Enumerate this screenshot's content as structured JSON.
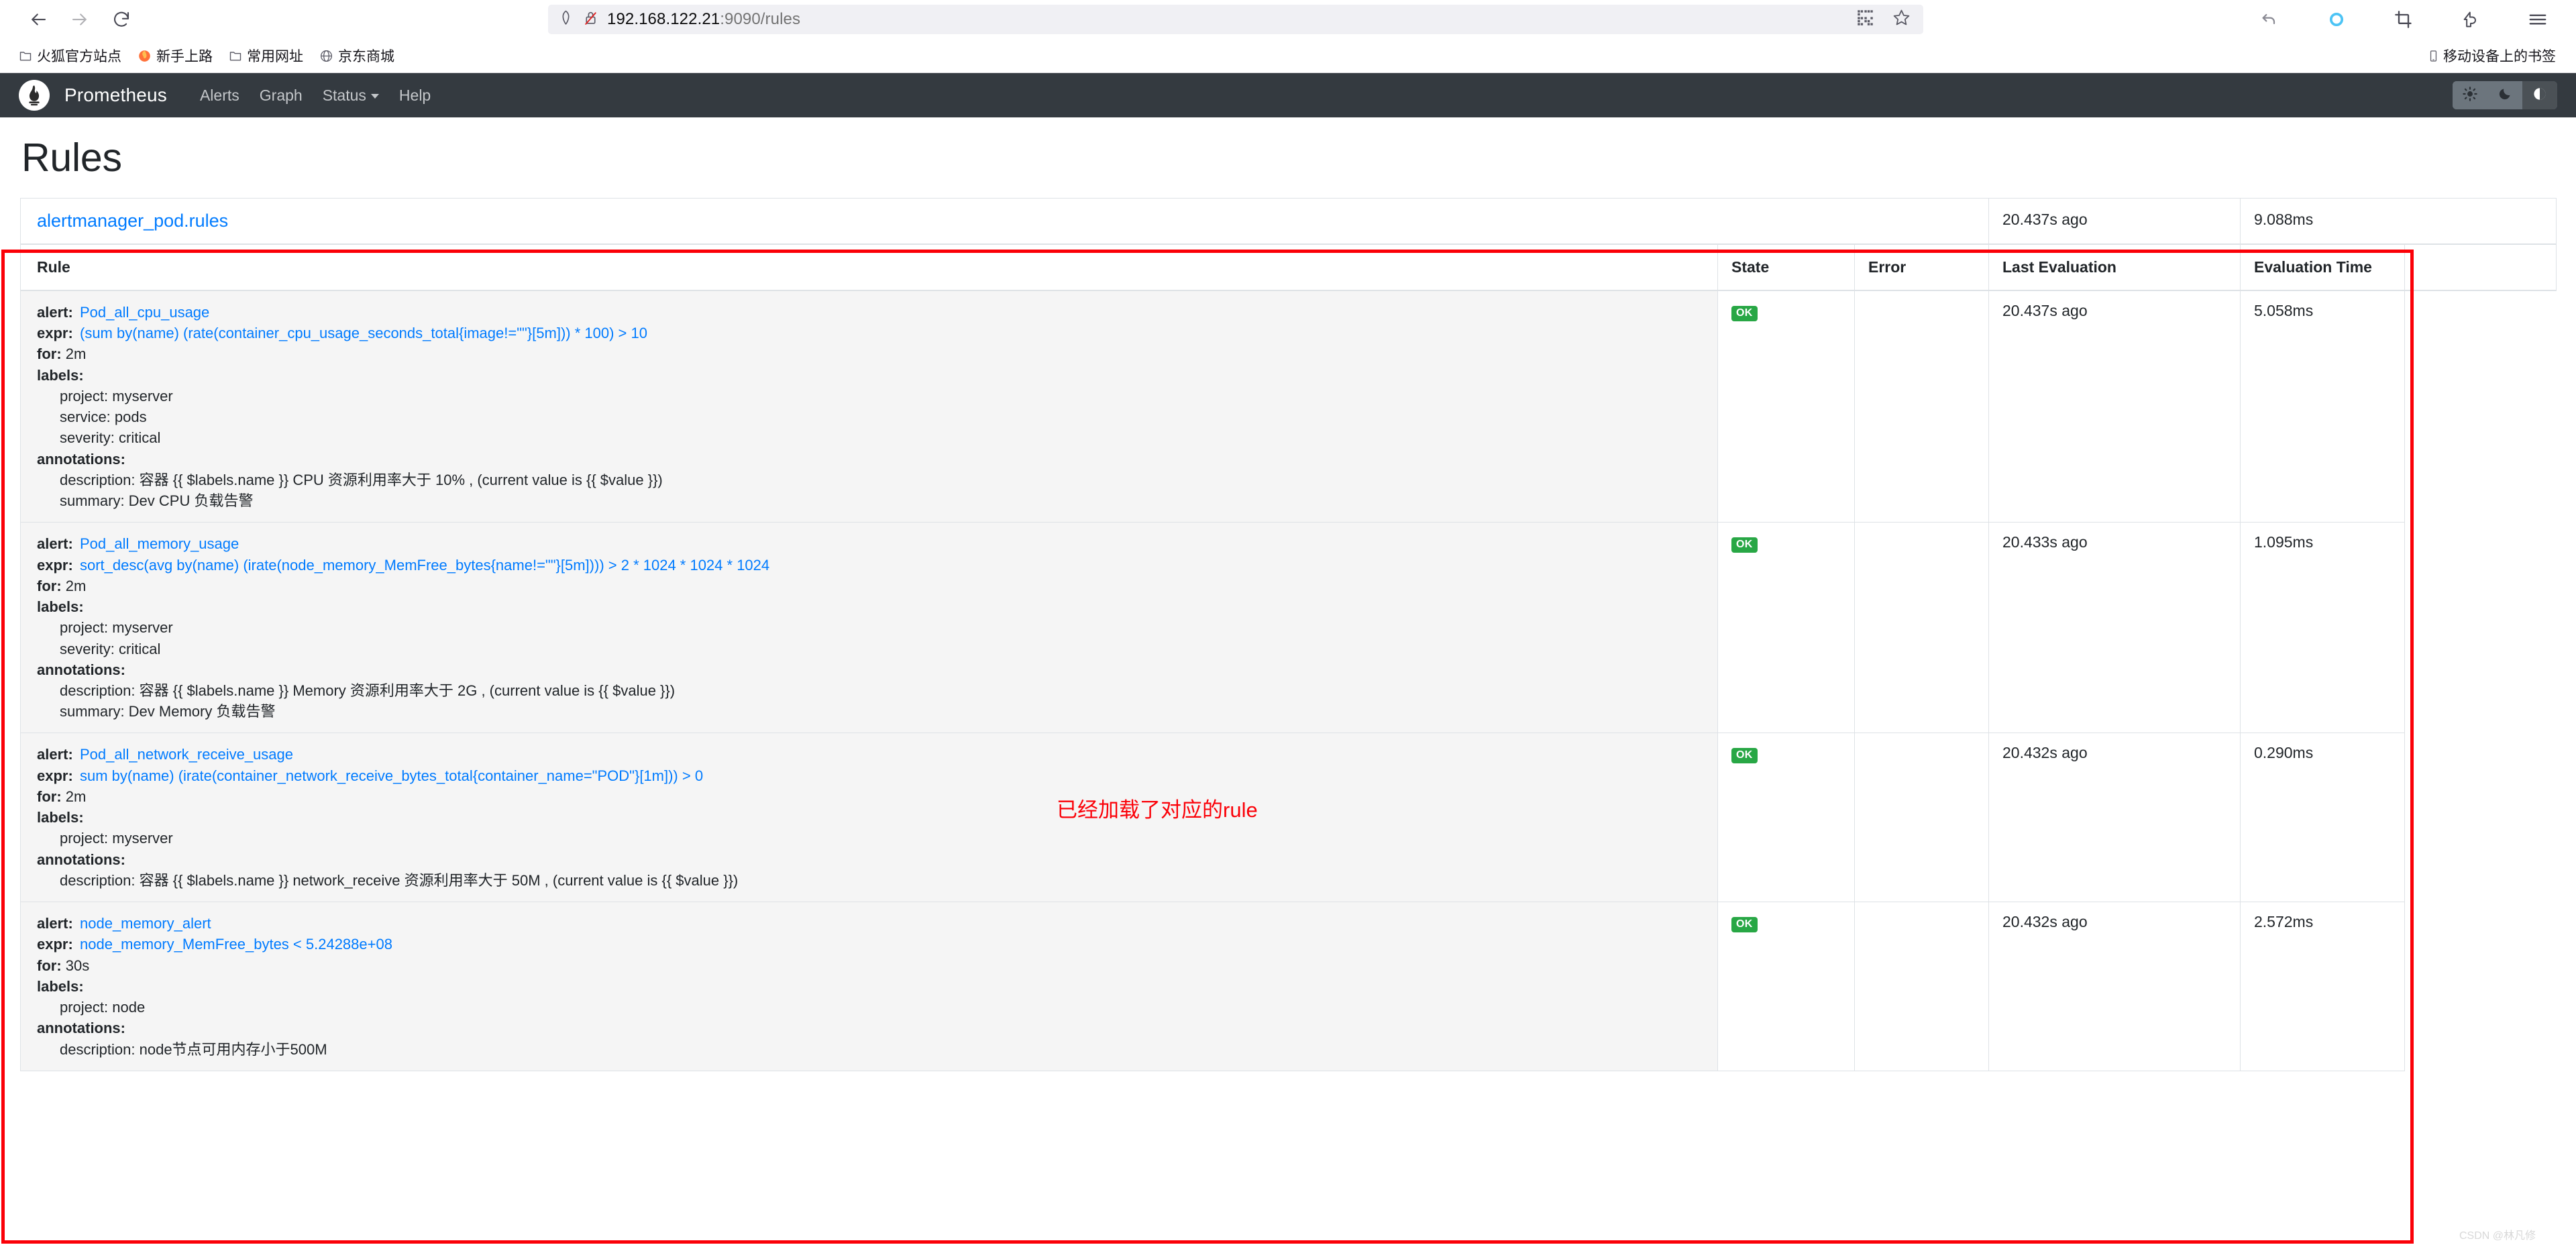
{
  "browser": {
    "back_icon": "back-arrow-icon",
    "forward_icon": "forward-arrow-icon",
    "reload_icon": "reload-icon",
    "shield_icon": "shield-icon",
    "insecure_icon": "broken-lock-icon",
    "url_host": "192.168.122.21",
    "url_rest": ":9090/rules",
    "qr_icon": "qr-code-icon",
    "bookmark_star_icon": "star-icon",
    "undo_icon": "undo-icon",
    "sync_icon": "sync-circle-icon",
    "screenshot_icon": "crop-icon",
    "extension_icon": "extension-icon",
    "menu_icon": "hamburger-menu-icon",
    "bookmarks": [
      {
        "label": "火狐官方站点",
        "icon": "folder-icon"
      },
      {
        "label": "新手上路",
        "icon": "firefox-icon"
      },
      {
        "label": "常用网址",
        "icon": "folder-icon"
      },
      {
        "label": "京东商城",
        "icon": "globe-icon"
      }
    ],
    "mobile_bookmarks": {
      "label": "移动设备上的书签",
      "icon": "phone-icon"
    }
  },
  "navbar": {
    "logo_icon": "prometheus-logo-icon",
    "brand": "Prometheus",
    "links": [
      {
        "label": "Alerts",
        "has_caret": false
      },
      {
        "label": "Graph",
        "has_caret": false
      },
      {
        "label": "Status",
        "has_caret": true
      },
      {
        "label": "Help",
        "has_caret": false
      }
    ],
    "theme_buttons": [
      {
        "name": "theme-light",
        "icon": "sun-icon",
        "active": false
      },
      {
        "name": "theme-dark",
        "icon": "moon-icon",
        "active": false
      },
      {
        "name": "theme-auto",
        "icon": "half-circle-icon",
        "active": true
      }
    ]
  },
  "page": {
    "title": "Rules"
  },
  "group": {
    "name": "alertmanager_pod.rules",
    "last_evaluation": "20.437s ago",
    "evaluation_time": "9.088ms"
  },
  "table": {
    "headers": {
      "rule": "Rule",
      "state": "State",
      "error": "Error",
      "last_evaluation": "Last Evaluation",
      "evaluation_time": "Evaluation Time"
    },
    "labels": {
      "alert": "alert:",
      "expr": "expr:",
      "for": "for:",
      "labels": "labels:",
      "annotations": "annotations:"
    },
    "rows": [
      {
        "alert": "Pod_all_cpu_usage",
        "expr": "(sum by(name) (rate(container_cpu_usage_seconds_total{image!=\"\"}[5m])) * 100) > 10",
        "for": "2m",
        "labels": [
          "project: myserver",
          "service: pods",
          "severity: critical"
        ],
        "annotations": [
          "description: 容器 {{ $labels.name }} CPU 资源利用率大于 10% , (current value is {{ $value }})",
          "summary: Dev CPU 负载告警"
        ],
        "state": "OK",
        "error": "",
        "last_evaluation": "20.437s ago",
        "evaluation_time": "5.058ms"
      },
      {
        "alert": "Pod_all_memory_usage",
        "expr": "sort_desc(avg by(name) (irate(node_memory_MemFree_bytes{name!=\"\"}[5m]))) > 2 * 1024 * 1024 * 1024",
        "for": "2m",
        "labels": [
          "project: myserver",
          "severity: critical"
        ],
        "annotations": [
          "description: 容器 {{ $labels.name }} Memory 资源利用率大于 2G , (current value is {{ $value }})",
          "summary: Dev Memory 负载告警"
        ],
        "state": "OK",
        "error": "",
        "last_evaluation": "20.433s ago",
        "evaluation_time": "1.095ms"
      },
      {
        "alert": "Pod_all_network_receive_usage",
        "expr": "sum by(name) (irate(container_network_receive_bytes_total{container_name=\"POD\"}[1m])) > 0",
        "for": "2m",
        "labels": [
          "project: myserver"
        ],
        "annotations": [
          "description: 容器 {{ $labels.name }} network_receive 资源利用率大于 50M , (current value is {{ $value }})"
        ],
        "state": "OK",
        "error": "",
        "last_evaluation": "20.432s ago",
        "evaluation_time": "0.290ms"
      },
      {
        "alert": "node_memory_alert",
        "expr": "node_memory_MemFree_bytes < 5.24288e+08",
        "for": "30s",
        "labels": [
          "project: node"
        ],
        "annotations": [
          "description: node节点可用内存小于500M"
        ],
        "state": "OK",
        "error": "",
        "last_evaluation": "20.432s ago",
        "evaluation_time": "2.572ms"
      }
    ]
  },
  "annotation": {
    "note": "已经加载了对应的rule",
    "note_color": "#fb0007",
    "box_color": "#fb0007"
  },
  "watermark": "CSDN @林凡修"
}
